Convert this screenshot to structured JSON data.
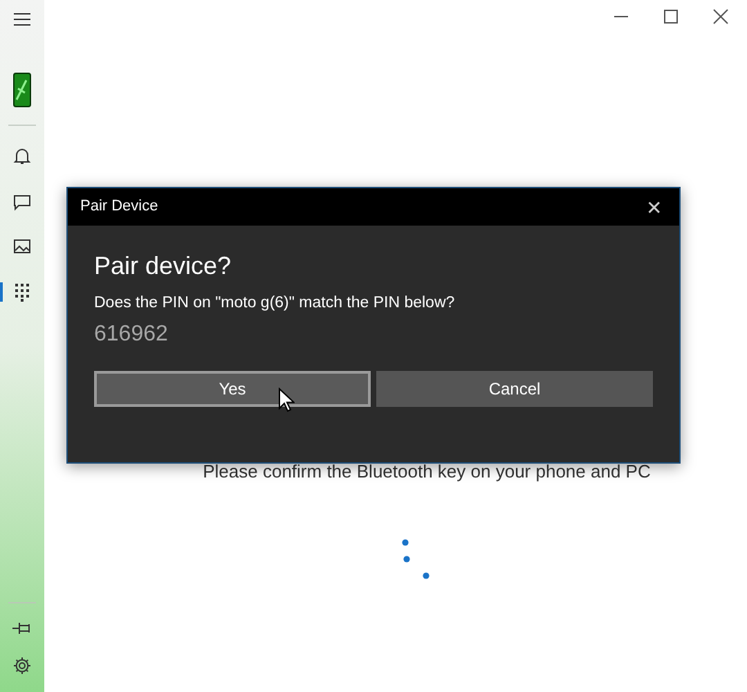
{
  "sidebar": {
    "items": [
      {
        "kind": "menu",
        "selected": false
      },
      {
        "kind": "phone",
        "selected": false
      },
      {
        "kind": "notifications",
        "selected": false
      },
      {
        "kind": "messages",
        "selected": false
      },
      {
        "kind": "photos",
        "selected": false
      },
      {
        "kind": "calls",
        "selected": true
      }
    ],
    "bottom_items": [
      {
        "kind": "pin"
      },
      {
        "kind": "settings"
      }
    ]
  },
  "main": {
    "status": "Please confirm the Bluetooth key on your phone and PC"
  },
  "dialog": {
    "title": "Pair Device",
    "close": "✕",
    "heading": "Pair device?",
    "question": "Does the PIN on \"moto g(6)\" match the PIN below?",
    "pin": "616962",
    "buttons": [
      {
        "label": "Yes",
        "focused": true
      },
      {
        "label": "Cancel",
        "focused": false
      }
    ]
  }
}
